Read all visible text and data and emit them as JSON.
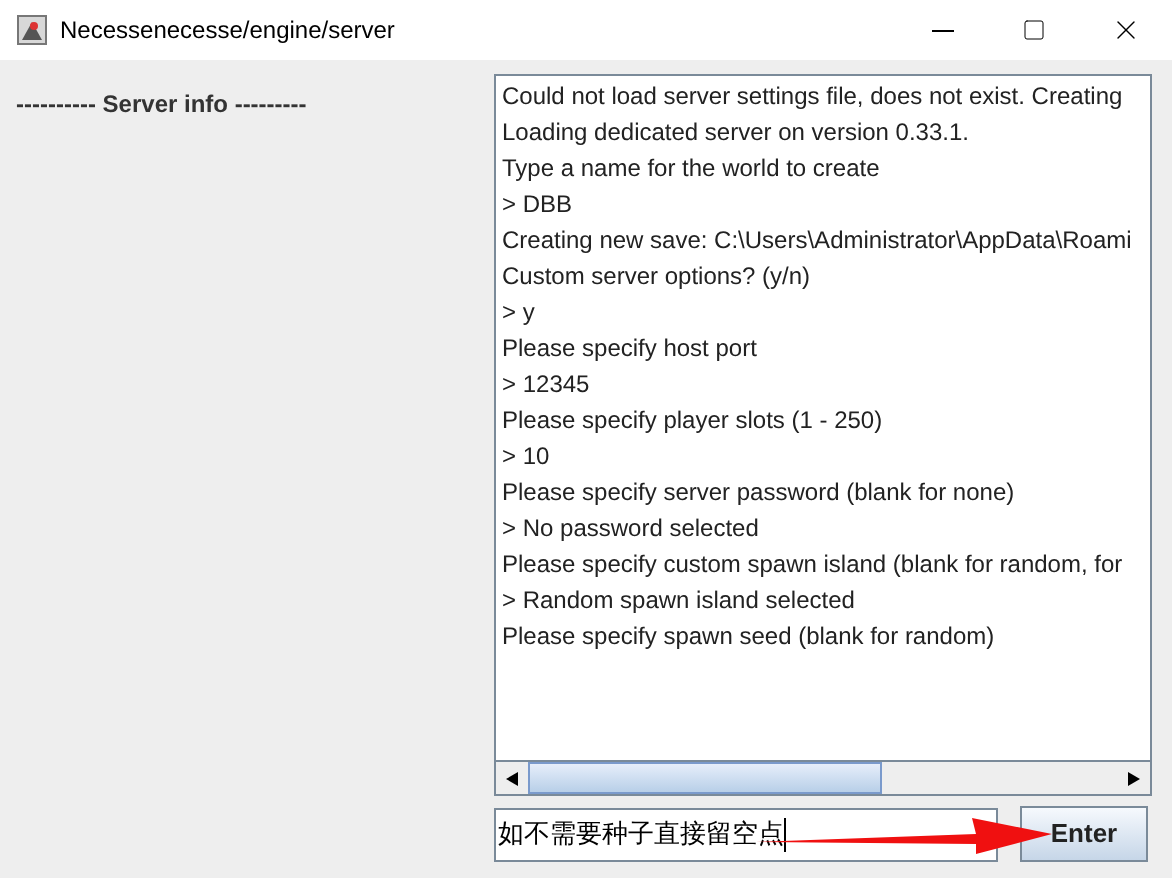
{
  "window": {
    "title": "Necessenecesse/engine/server"
  },
  "server_info": {
    "heading": "---------- Server info ---------"
  },
  "log": {
    "lines": [
      "Could not load server settings file, does not exist. Creating",
      "Loading dedicated server on version 0.33.1.",
      "Type a name for the world to create",
      "> DBB",
      "Creating new save: C:\\Users\\Administrator\\AppData\\Roami",
      "Custom server options? (y/n)",
      "> y",
      "Please specify host port",
      "> 12345",
      "Please specify player slots (1 - 250)",
      "> 10",
      "Please specify server password (blank for none)",
      "> No password selected",
      "Please specify custom spawn island (blank for random, for",
      "> Random spawn island selected",
      "Please specify spawn seed (blank for random)"
    ]
  },
  "input": {
    "value": "如不需要种子直接留空点"
  },
  "enter_button": {
    "label": "Enter"
  }
}
